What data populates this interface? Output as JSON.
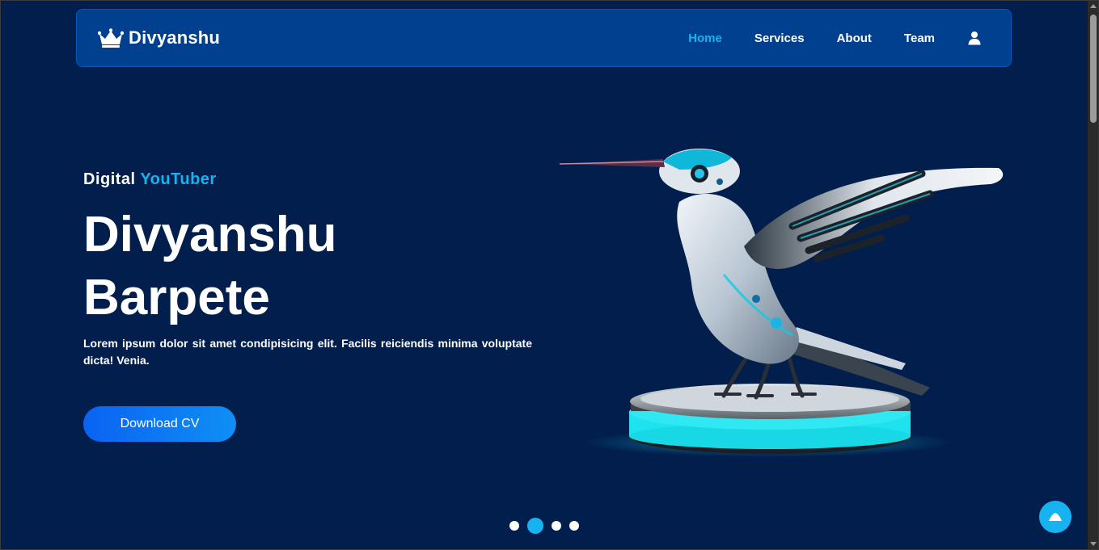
{
  "brand": {
    "name": "Divyanshu",
    "icon": "crown-icon"
  },
  "nav": {
    "links": [
      {
        "label": "Home",
        "active": true
      },
      {
        "label": "Services",
        "active": false
      },
      {
        "label": "About",
        "active": false
      },
      {
        "label": "Team",
        "active": false
      }
    ],
    "account_icon": "user-icon"
  },
  "hero": {
    "eyebrow_prefix": "Digital",
    "eyebrow_accent": "YouTuber",
    "title_line1": "Divyanshu",
    "title_line2": "Barpete",
    "description": "Lorem ipsum dolor sit amet condipisicing elit. Facilis reiciendis minima voluptate dicta! Venia.",
    "cta_label": "Download CV",
    "image": "robotic-hummingbird-on-glowing-pedestal"
  },
  "carousel": {
    "slide_count": 4,
    "active_index": 1
  },
  "colors": {
    "background": "#011e4d",
    "navbar": "#00408f",
    "accent": "#16b3f0",
    "cta_start": "#0a63f2",
    "cta_end": "#0f8ff5",
    "text": "#ffffff"
  },
  "back_to_top_icon": "chevron-up-icon"
}
